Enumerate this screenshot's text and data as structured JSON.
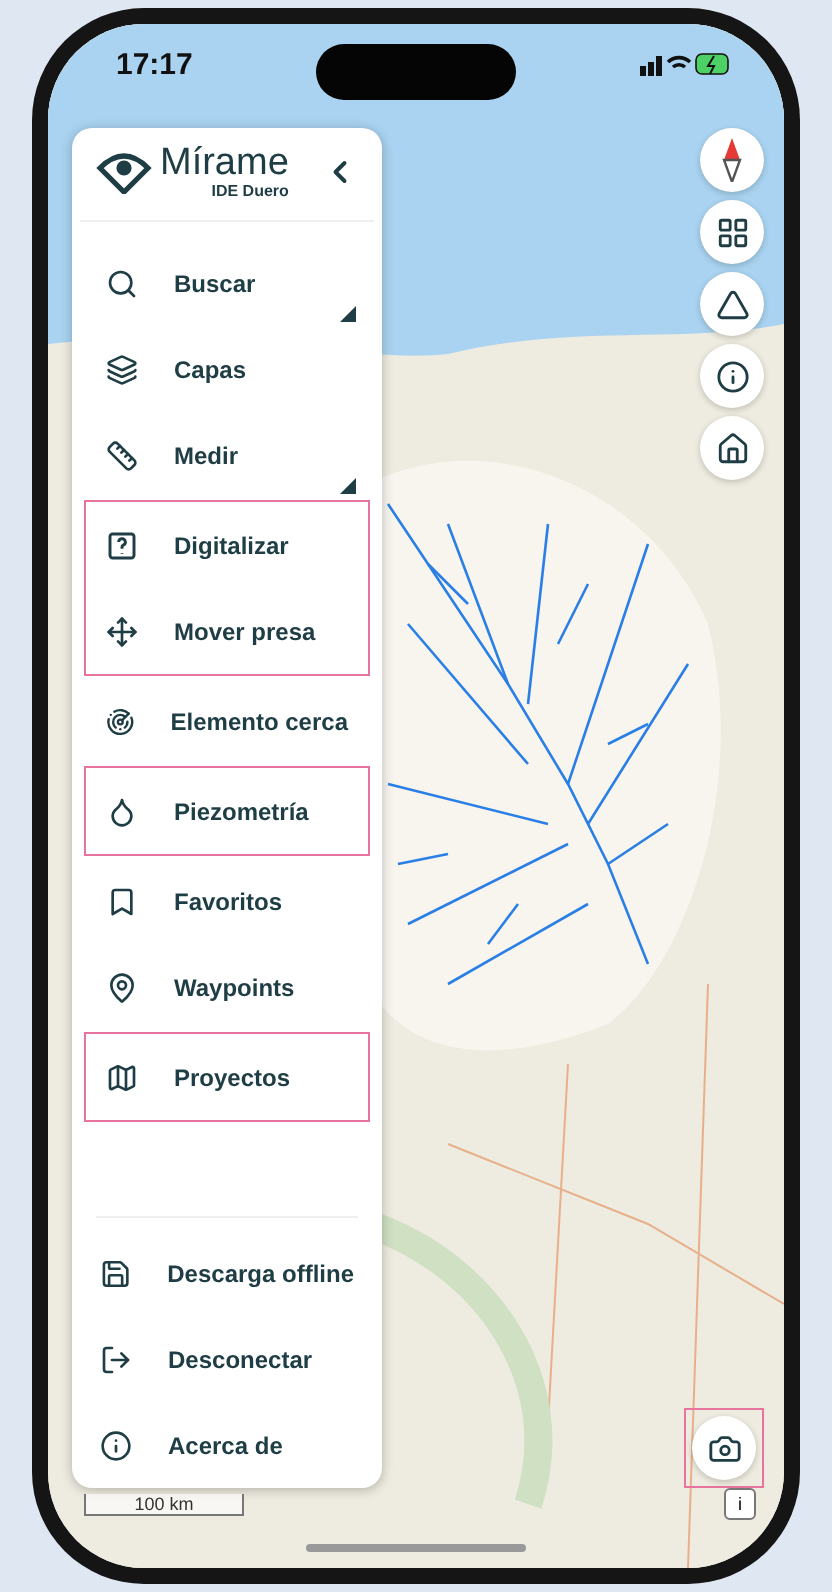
{
  "status_bar": {
    "time": "17:17"
  },
  "menu": {
    "logo": {
      "title": "Mírame",
      "subtitle": "IDE Duero"
    },
    "groups": [
      {
        "highlighted": false,
        "items": [
          {
            "label": "Buscar",
            "has_submenu": true
          },
          {
            "label": "Capas",
            "has_submenu": false
          },
          {
            "label": "Medir",
            "has_submenu": true
          }
        ]
      },
      {
        "highlighted": true,
        "items": [
          {
            "label": "Digitalizar",
            "has_submenu": false
          },
          {
            "label": "Mover presa",
            "has_submenu": false
          }
        ]
      },
      {
        "highlighted": false,
        "items": [
          {
            "label": "Elemento cerca",
            "has_submenu": false
          }
        ]
      },
      {
        "highlighted": true,
        "items": [
          {
            "label": "Piezometría",
            "has_submenu": false
          }
        ]
      },
      {
        "highlighted": false,
        "items": [
          {
            "label": "Favoritos",
            "has_submenu": false
          },
          {
            "label": "Waypoints",
            "has_submenu": false
          }
        ]
      },
      {
        "highlighted": true,
        "items": [
          {
            "label": "Proyectos",
            "has_submenu": false
          }
        ]
      }
    ],
    "footer_items": [
      {
        "label": "Descarga offline"
      },
      {
        "label": "Desconectar"
      },
      {
        "label": "Acerca de"
      }
    ]
  },
  "map_controls": {
    "camera_highlighted": true
  },
  "scale_bar": {
    "label": "100 km"
  },
  "attribution": {
    "label": "i"
  }
}
